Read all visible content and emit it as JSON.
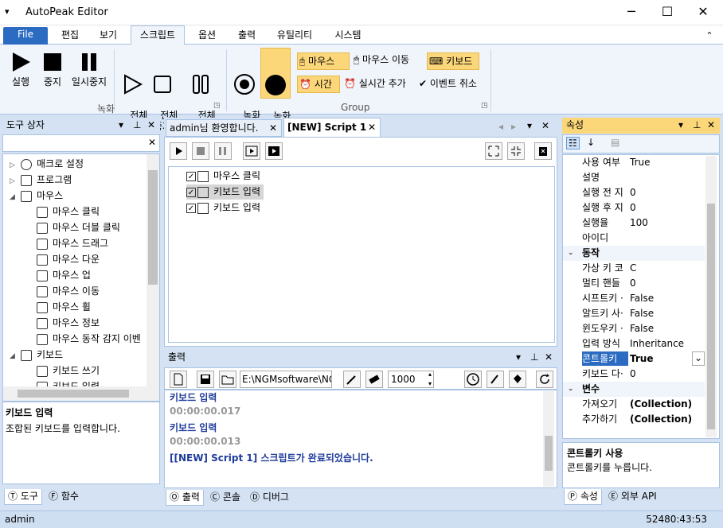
{
  "window": {
    "title": "AutoPeak Editor",
    "min": "─",
    "max": "☐",
    "close": "✕"
  },
  "menu": {
    "file": "File",
    "items": [
      "편집",
      "보기",
      "스크립트",
      "옵션",
      "출력",
      "유틸리티",
      "시스템"
    ]
  },
  "ribbon": {
    "run": "실행",
    "stop": "중지",
    "pause": "일시중지",
    "run_all": "전체\n실행",
    "stop_all": "전체\n중지",
    "pause_all": "전체\n일시중지",
    "rec_start": "녹화\n시작",
    "rec_stop": "녹화\n중지",
    "mouse": "마우스",
    "mouse_move": "마우스 이동",
    "keyboard": "키보드",
    "time": "시간",
    "realtime_add": "실시간 추가",
    "event_cancel": "이벤트 취소",
    "group_record": "녹화",
    "group_group": "Group"
  },
  "toolbox": {
    "title": "도구 상자",
    "search_placeholder": "",
    "items": [
      {
        "label": "매크로 설정",
        "level": 0,
        "exp": "▷",
        "icon": "globe-icon"
      },
      {
        "label": "프로그램",
        "level": 0,
        "exp": "▷",
        "icon": "program-icon"
      },
      {
        "label": "마우스",
        "level": 0,
        "exp": "◢",
        "icon": "mouse-icon"
      },
      {
        "label": "마우스 클릭",
        "level": 1,
        "icon": "mouse-click-icon"
      },
      {
        "label": "마우스 더블 클릭",
        "level": 1,
        "icon": "mouse-double-click-icon"
      },
      {
        "label": "마우스 드래그",
        "level": 1,
        "icon": "mouse-drag-icon"
      },
      {
        "label": "마우스 다운",
        "level": 1,
        "icon": "mouse-down-icon"
      },
      {
        "label": "마우스 업",
        "level": 1,
        "icon": "mouse-up-icon"
      },
      {
        "label": "마우스 이동",
        "level": 1,
        "icon": "move-icon"
      },
      {
        "label": "마우스 휠",
        "level": 1,
        "icon": "mouse-wheel-icon"
      },
      {
        "label": "마우스 정보",
        "level": 1,
        "icon": "info-icon"
      },
      {
        "label": "마우스 동작 감지 이벤",
        "level": 1,
        "icon": "lightning-icon"
      },
      {
        "label": "키보드",
        "level": 0,
        "exp": "◢",
        "icon": "keyboard-icon"
      },
      {
        "label": "키보드 쓰기",
        "level": 1,
        "icon": "book-icon"
      },
      {
        "label": "키보드 입력",
        "level": 1,
        "icon": "keyboard-icon"
      }
    ],
    "desc_title": "키보드 입력",
    "desc_text": "조합된 키보드를 입력합니다.",
    "tabs": [
      "도구",
      "함수"
    ]
  },
  "editor": {
    "tabs": [
      "admin님 환영합니다.",
      "[NEW] Script 1"
    ],
    "lines": [
      {
        "label": "마우스 클릭",
        "icon": "mouse-click-icon"
      },
      {
        "label": "키보드 입력",
        "icon": "keyboard-icon"
      },
      {
        "label": "키보드 입력",
        "icon": "keyboard-icon"
      }
    ]
  },
  "output": {
    "title": "출력",
    "path": "E:\\NGMsoftware\\NG",
    "count": "1000",
    "lines": [
      {
        "text": "키보드 입력",
        "kind": "action"
      },
      {
        "text": "00:00:00.017",
        "kind": "time"
      },
      {
        "text": "키보드 입력",
        "kind": "action"
      },
      {
        "text": "00:00:00.013",
        "kind": "time"
      },
      {
        "text": "[[NEW] Script 1] 스크립트가 완료되었습니다.",
        "kind": "msg"
      }
    ],
    "tabs": [
      "출력",
      "콘솔",
      "디버그"
    ]
  },
  "properties": {
    "title": "속성",
    "rows": [
      {
        "k": "사용 여부",
        "v": "True"
      },
      {
        "k": "설명",
        "v": ""
      },
      {
        "k": "실행 전 지",
        "v": "0"
      },
      {
        "k": "실행 후 지",
        "v": "0"
      },
      {
        "k": "실행율",
        "v": "100"
      },
      {
        "k": "아이디",
        "v": ""
      },
      {
        "cat": "동작"
      },
      {
        "k": "가상 키 코",
        "v": "C"
      },
      {
        "k": "멀티 핸들",
        "v": "0"
      },
      {
        "k": "시프트키 ·",
        "v": "False"
      },
      {
        "k": "알트키 사·",
        "v": "False"
      },
      {
        "k": "윈도우키 ·",
        "v": "False"
      },
      {
        "k": "입력 방식",
        "v": "Inheritance"
      },
      {
        "k": "콘트롤키",
        "v": "True",
        "sel": true
      },
      {
        "k": "키보드 다·",
        "v": "0"
      },
      {
        "cat": "변수"
      },
      {
        "k": "가져오기",
        "v": "(Collection)",
        "bold": true
      },
      {
        "k": "추가하기",
        "v": "(Collection)",
        "bold": true
      }
    ],
    "desc_title": "콘트롤키 사용",
    "desc_text": "콘트롤키를 누릅니다.",
    "tabs": [
      "속성",
      "외부 API"
    ]
  },
  "status": {
    "user": "admin",
    "clock": "52480:43:53"
  }
}
